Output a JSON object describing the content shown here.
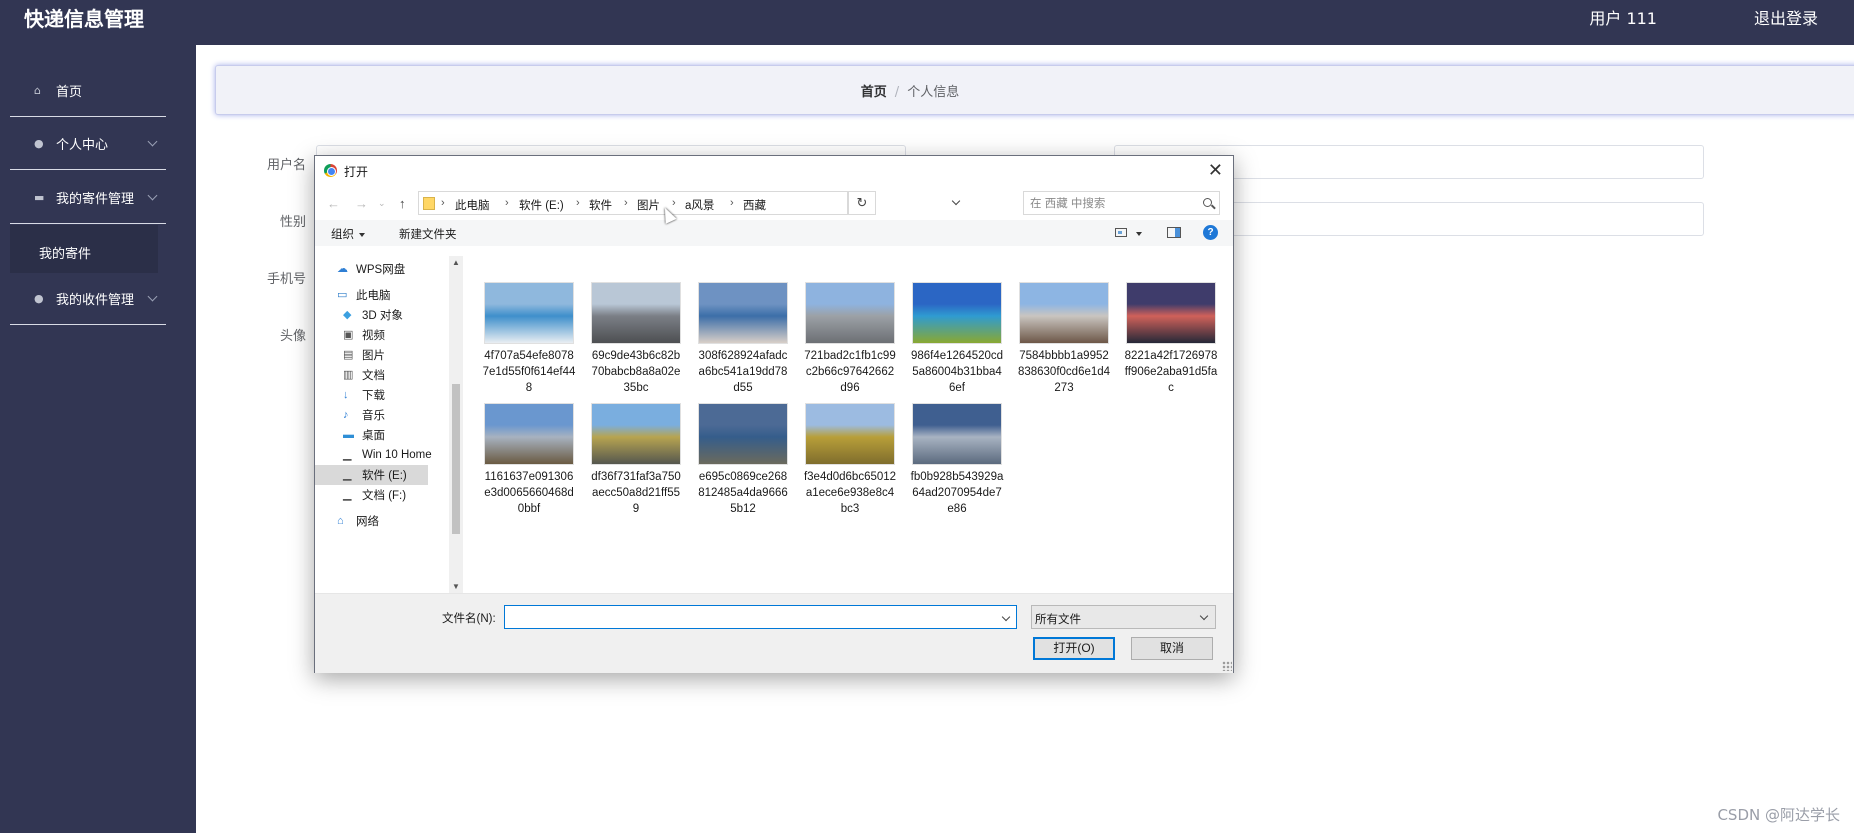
{
  "app": {
    "title": "快递信息管理",
    "user": "用户 111",
    "logout": "退出登录"
  },
  "sidebar": {
    "items": [
      {
        "label": "首页",
        "icon": "home-icon"
      },
      {
        "label": "个人中心",
        "icon": "user-icon"
      },
      {
        "label": "我的寄件管理",
        "icon": "briefcase-icon"
      },
      {
        "label": "我的收件管理",
        "icon": "user-icon"
      }
    ],
    "submenu": {
      "label": "我的寄件"
    }
  },
  "breadcrumb": {
    "home": "首页",
    "separator": "/",
    "current": "个人信息"
  },
  "form": {
    "username_label": "用户名",
    "gender_label": "性别",
    "phone_label": "手机号",
    "avatar_label": "头像"
  },
  "watermark": "CSDN @阿达学长",
  "dialog": {
    "title": "打开",
    "breadcrumb": [
      "此电脑",
      "软件 (E:)",
      "软件",
      "图片",
      "a风景",
      "西藏"
    ],
    "search_placeholder": "在 西藏 中搜索",
    "toolbar": {
      "organize": "组织",
      "new_folder": "新建文件夹"
    },
    "nav": [
      {
        "label": "WPS网盘",
        "icon": "cloud-icon"
      },
      {
        "label": "此电脑",
        "icon": "computer-icon"
      },
      {
        "label": "3D 对象",
        "icon": "cube-icon"
      },
      {
        "label": "视频",
        "icon": "video-icon"
      },
      {
        "label": "图片",
        "icon": "picture-icon"
      },
      {
        "label": "文档",
        "icon": "document-icon"
      },
      {
        "label": "下载",
        "icon": "download-icon"
      },
      {
        "label": "音乐",
        "icon": "music-icon"
      },
      {
        "label": "桌面",
        "icon": "desktop-icon"
      },
      {
        "label": "Win 10 Home",
        "icon": "drive-icon"
      },
      {
        "label": "软件 (E:)",
        "icon": "drive-icon"
      },
      {
        "label": "文档 (F:)",
        "icon": "drive-icon"
      },
      {
        "label": "网络",
        "icon": "network-icon"
      }
    ],
    "files": [
      {
        "name": "4f707a54efe80787e1d55f0f614ef448",
        "colors": [
          "#8fb8dd",
          "#3e8fcb",
          "#e9eef2"
        ]
      },
      {
        "name": "69c9de43b6c82b70babcb8a8a02e35bc",
        "colors": [
          "#b9c7d6",
          "#7b7f86",
          "#4d4f52"
        ]
      },
      {
        "name": "308f628924afadca6bc541a19dd78d55",
        "colors": [
          "#6e92c2",
          "#3c6ea8",
          "#d8cfc8"
        ]
      },
      {
        "name": "721bad2c1fb1c99c2b66c97642662d96",
        "colors": [
          "#8eb3df",
          "#9ca1a6",
          "#6c6f74"
        ]
      },
      {
        "name": "986f4e1264520cd5a86004b31bba46ef",
        "colors": [
          "#2b66c4",
          "#2f9bd1",
          "#8aa832"
        ]
      },
      {
        "name": "7584bbbb1a9952838630f0cd6e1d4273",
        "colors": [
          "#8db5e3",
          "#c9c5c0",
          "#6d5748"
        ]
      },
      {
        "name": "8221a42f1726978ff906e2aba91d5fac",
        "colors": [
          "#3f3c6b",
          "#d0615a",
          "#252838"
        ]
      },
      {
        "name": "1161637e091306e3d0065660468d0bbf",
        "colors": [
          "#6a97cf",
          "#a7b2c0",
          "#6a5a42"
        ]
      },
      {
        "name": "df36f731faf3a750aecc50a8d21ff559",
        "colors": [
          "#7aaedf",
          "#b7a450",
          "#55574f"
        ]
      },
      {
        "name": "e695c0869ce268812485a4da96665b12",
        "colors": [
          "#4c6a95",
          "#355d8b",
          "#6b6a5d"
        ]
      },
      {
        "name": "f3e4d0d6bc65012a1ece6e938e8c4bc3",
        "colors": [
          "#9cbbe1",
          "#b89f39",
          "#7f6d2d"
        ]
      },
      {
        "name": "fb0b928b543929a64ad2070954de7e86",
        "colors": [
          "#3f5f90",
          "#a8b3c2",
          "#5b6a7e"
        ]
      }
    ],
    "filename_label": "文件名(N):",
    "filename_value": "",
    "filetype": "所有文件",
    "open_button": "打开(O)",
    "cancel_button": "取消"
  }
}
